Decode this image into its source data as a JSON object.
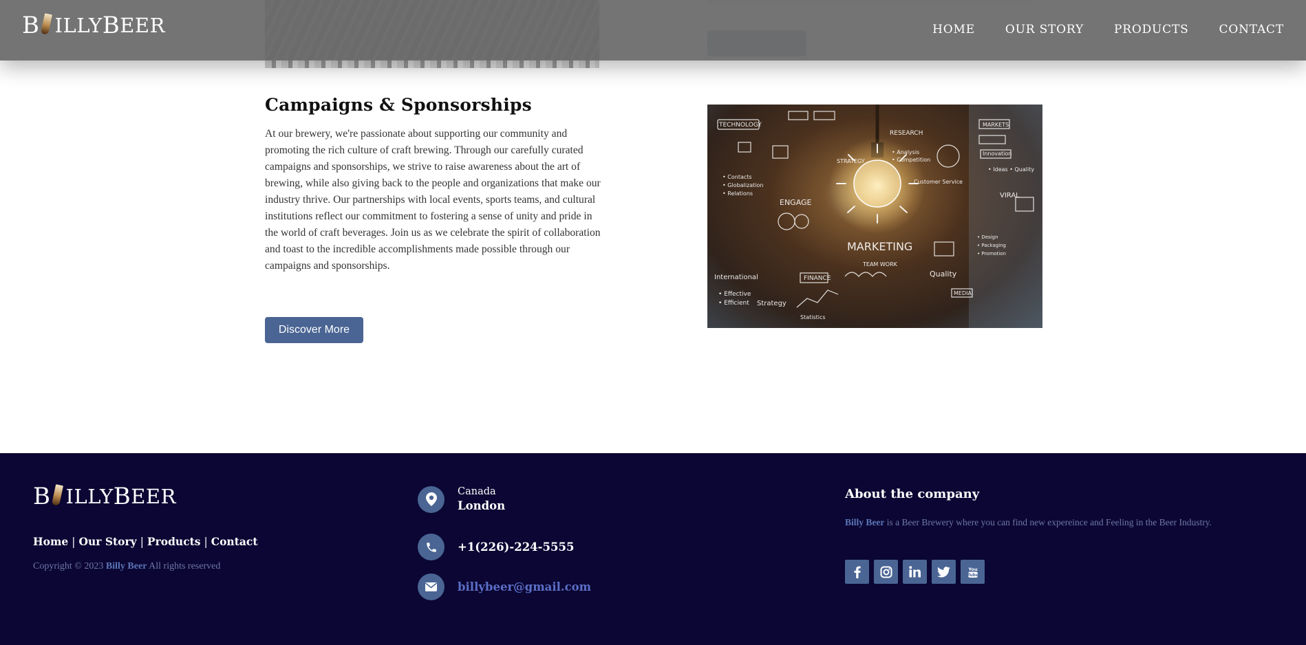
{
  "header": {
    "logo_prefix": "B",
    "logo_rest": "ILLY ",
    "logo_word2_first": "B",
    "logo_word2_rest": "EER",
    "nav": [
      "HOME",
      "OUR STORY",
      "PRODUCTS",
      "CONTACT"
    ]
  },
  "section": {
    "title": "Campaigns & Sponsorships",
    "body": "At our brewery, we're passionate about supporting our community and promoting the rich culture of craft brewing. Through our carefully curated campaigns and sponsorships, we strive to raise awareness about the art of brewing, while also giving back to the people and organizations that make our industry thrive. Our partnerships with local events, sports teams, and cultural institutions reflect our commitment to fostering a sense of unity and pride in the world of craft beverages. Join us as we celebrate the spirit of collaboration and toast to the incredible accomplishments made possible through our campaigns and sponsorships.",
    "button": "Discover More",
    "image_words": [
      "TECHNOLOGY",
      "RESEARCH",
      "MARKETS",
      "ENGAGE",
      "STRATEGY",
      "VIRAL",
      "MARKETING",
      "TEAM WORK",
      "Quality",
      "International",
      "FINANCE",
      "MEDIA",
      "Strategy",
      "Statistics",
      "Innovation",
      "Globalization",
      "Relations",
      "Analysis",
      "Competition",
      "Customer Service",
      "Effective",
      "Efficient",
      "Research",
      "Ideas",
      "Design",
      "Packaging",
      "Promotion"
    ]
  },
  "footer": {
    "links": [
      "Home",
      "Our Story",
      "Products",
      "Contact"
    ],
    "copyright_pre": "Copyright © 2023",
    "copyright_brand": "Billy Beer",
    "copyright_post": "All rights reserved",
    "country": "Canada",
    "city": "London",
    "phone": "+1(226)-224-5555",
    "email": "billybeer@gmail.com",
    "about_title": "About the company",
    "about_brand": "Billy Beer",
    "about_text": "is a Beer Brewery where you can find new expereince and Feeling in the Beer Industry.",
    "socials": [
      "facebook-icon",
      "instagram-icon",
      "linkedin-icon",
      "twitter-icon",
      "youtube-icon"
    ]
  },
  "colors": {
    "accent": "#4a6594",
    "footer_bg": "#0b0633",
    "link_blue": "#5b6fc7",
    "muted": "#6f78a8"
  }
}
